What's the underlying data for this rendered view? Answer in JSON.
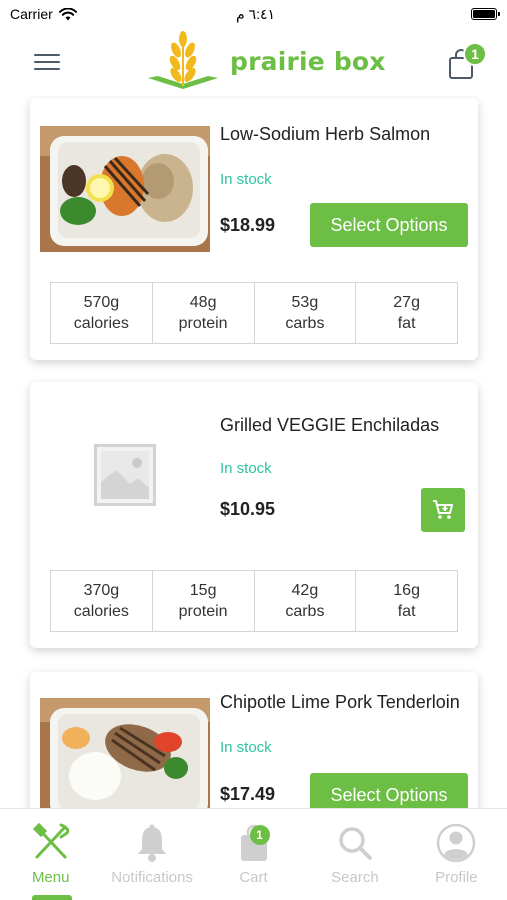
{
  "status_bar": {
    "carrier": "Carrier",
    "time": "٦:٤١ م"
  },
  "header": {
    "logo_text": "prairie box",
    "cart_count": "1",
    "brand_color": "#6cbe45"
  },
  "products": [
    {
      "title": "Low-Sodium Herb Salmon",
      "stock": "In stock",
      "price": "$18.99",
      "action": "Select Options",
      "image": "salmon-meal-photo",
      "macros": [
        {
          "value": "570g",
          "label": "calories"
        },
        {
          "value": "48g",
          "label": "protein"
        },
        {
          "value": "53g",
          "label": "carbs"
        },
        {
          "value": "27g",
          "label": "fat"
        }
      ]
    },
    {
      "title": "Grilled VEGGIE Enchiladas",
      "stock": "In stock",
      "price": "$10.95",
      "action": "add-to-cart-icon",
      "image": "image-placeholder-icon",
      "macros": [
        {
          "value": "370g",
          "label": "calories"
        },
        {
          "value": "15g",
          "label": "protein"
        },
        {
          "value": "42g",
          "label": "carbs"
        },
        {
          "value": "16g",
          "label": "fat"
        }
      ]
    },
    {
      "title": "Chipotle Lime Pork Tenderloin",
      "stock": "In stock",
      "price": "$17.49",
      "action": "Select Options",
      "image": "pork-meal-photo"
    }
  ],
  "bottom_nav": {
    "items": [
      {
        "label": "Menu",
        "icon": "fork-knife-icon",
        "active": true
      },
      {
        "label": "Notifications",
        "icon": "bell-icon"
      },
      {
        "label": "Cart",
        "icon": "bag-icon",
        "badge": "1"
      },
      {
        "label": "Search",
        "icon": "search-icon"
      },
      {
        "label": "Profile",
        "icon": "profile-icon"
      }
    ]
  }
}
